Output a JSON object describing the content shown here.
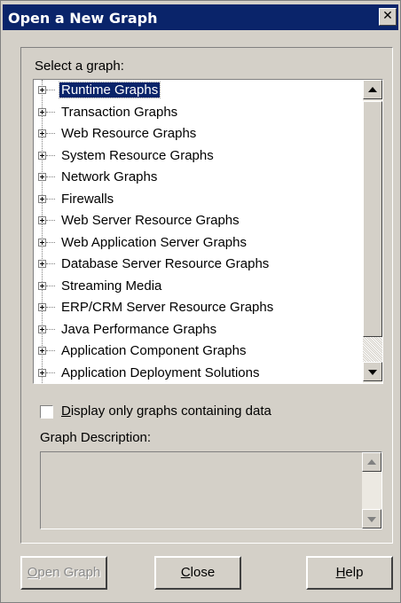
{
  "window": {
    "title": "Open a New Graph",
    "close_glyph": "✕"
  },
  "select_label": "Select a graph:",
  "tree": {
    "items": [
      {
        "label": "Runtime Graphs",
        "selected": true
      },
      {
        "label": "Transaction Graphs"
      },
      {
        "label": "Web Resource Graphs"
      },
      {
        "label": "System Resource Graphs"
      },
      {
        "label": "Network Graphs"
      },
      {
        "label": "Firewalls"
      },
      {
        "label": "Web Server Resource Graphs"
      },
      {
        "label": "Web Application Server Graphs"
      },
      {
        "label": "Database Server Resource Graphs"
      },
      {
        "label": "Streaming Media"
      },
      {
        "label": "ERP/CRM Server Resource Graphs"
      },
      {
        "label": "Java Performance Graphs"
      },
      {
        "label": "Application Component Graphs"
      },
      {
        "label": "Application Deployment Solutions"
      }
    ]
  },
  "checkbox": {
    "accel": "D",
    "rest": "isplay only graphs containing data",
    "checked": false
  },
  "description_label": "Graph Description:",
  "buttons": {
    "open": {
      "accel": "O",
      "rest": "pen Graph",
      "enabled": false
    },
    "close": {
      "accel": "C",
      "rest": "lose"
    },
    "help": {
      "accel": "H",
      "rest": "elp"
    }
  },
  "colors": {
    "titlebar": "#0a246a",
    "face": "#d4d0c8",
    "selection": "#0a246a"
  }
}
